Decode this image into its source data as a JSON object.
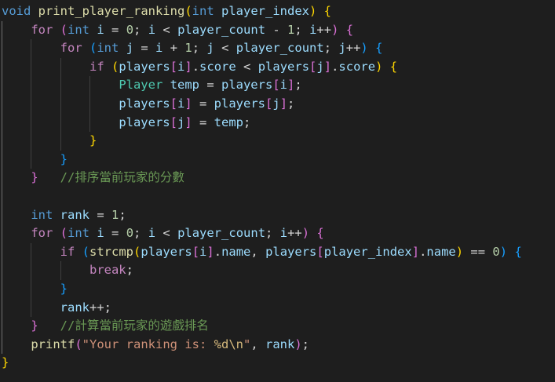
{
  "colors": {
    "background": "#1e1e1e",
    "keyword": "#569cd6",
    "control": "#c586c0",
    "function": "#dcdcaa",
    "variable": "#9cdcfe",
    "number": "#b5cea8",
    "string": "#ce9178",
    "type": "#4ec9b0",
    "comment": "#6a9955",
    "bracket_gold": "#ffd700",
    "bracket_orchid": "#da70d6",
    "bracket_blue": "#179fff"
  },
  "code": {
    "lines": [
      [
        [
          "void",
          "kw"
        ],
        [
          " ",
          "op"
        ],
        [
          "print_player_ranking",
          "fn"
        ],
        [
          "(",
          "b1"
        ],
        [
          "int",
          "kw"
        ],
        [
          " ",
          "op"
        ],
        [
          "player_index",
          "var"
        ],
        [
          ")",
          "b1"
        ],
        [
          " ",
          "op"
        ],
        [
          "{",
          "b1"
        ]
      ],
      [
        [
          "    ",
          "op"
        ],
        [
          "for",
          "ctl"
        ],
        [
          " ",
          "op"
        ],
        [
          "(",
          "b2"
        ],
        [
          "int",
          "kw"
        ],
        [
          " ",
          "op"
        ],
        [
          "i",
          "var"
        ],
        [
          " = ",
          "op"
        ],
        [
          "0",
          "num"
        ],
        [
          "; ",
          "op"
        ],
        [
          "i",
          "var"
        ],
        [
          " < ",
          "op"
        ],
        [
          "player_count",
          "var"
        ],
        [
          " - ",
          "op"
        ],
        [
          "1",
          "num"
        ],
        [
          "; ",
          "op"
        ],
        [
          "i",
          "var"
        ],
        [
          "++",
          "op"
        ],
        [
          ")",
          "b2"
        ],
        [
          " ",
          "op"
        ],
        [
          "{",
          "b2"
        ]
      ],
      [
        [
          "        ",
          "op"
        ],
        [
          "for",
          "ctl"
        ],
        [
          " ",
          "op"
        ],
        [
          "(",
          "b3"
        ],
        [
          "int",
          "kw"
        ],
        [
          " ",
          "op"
        ],
        [
          "j",
          "var"
        ],
        [
          " = ",
          "op"
        ],
        [
          "i",
          "var"
        ],
        [
          " + ",
          "op"
        ],
        [
          "1",
          "num"
        ],
        [
          "; ",
          "op"
        ],
        [
          "j",
          "var"
        ],
        [
          " < ",
          "op"
        ],
        [
          "player_count",
          "var"
        ],
        [
          "; ",
          "op"
        ],
        [
          "j",
          "var"
        ],
        [
          "++",
          "op"
        ],
        [
          ")",
          "b3"
        ],
        [
          " ",
          "op"
        ],
        [
          "{",
          "b3"
        ]
      ],
      [
        [
          "            ",
          "op"
        ],
        [
          "if",
          "ctl"
        ],
        [
          " ",
          "op"
        ],
        [
          "(",
          "b1"
        ],
        [
          "players",
          "var"
        ],
        [
          "[",
          "b2"
        ],
        [
          "i",
          "var"
        ],
        [
          "]",
          "b2"
        ],
        [
          ".",
          "op"
        ],
        [
          "score",
          "var"
        ],
        [
          " < ",
          "op"
        ],
        [
          "players",
          "var"
        ],
        [
          "[",
          "b2"
        ],
        [
          "j",
          "var"
        ],
        [
          "]",
          "b2"
        ],
        [
          ".",
          "op"
        ],
        [
          "score",
          "var"
        ],
        [
          ")",
          "b1"
        ],
        [
          " ",
          "op"
        ],
        [
          "{",
          "b1"
        ]
      ],
      [
        [
          "                ",
          "op"
        ],
        [
          "Player",
          "typ"
        ],
        [
          " ",
          "op"
        ],
        [
          "temp",
          "var"
        ],
        [
          " = ",
          "op"
        ],
        [
          "players",
          "var"
        ],
        [
          "[",
          "b2"
        ],
        [
          "i",
          "var"
        ],
        [
          "]",
          "b2"
        ],
        [
          ";",
          "op"
        ]
      ],
      [
        [
          "                ",
          "op"
        ],
        [
          "players",
          "var"
        ],
        [
          "[",
          "b2"
        ],
        [
          "i",
          "var"
        ],
        [
          "]",
          "b2"
        ],
        [
          " = ",
          "op"
        ],
        [
          "players",
          "var"
        ],
        [
          "[",
          "b2"
        ],
        [
          "j",
          "var"
        ],
        [
          "]",
          "b2"
        ],
        [
          ";",
          "op"
        ]
      ],
      [
        [
          "                ",
          "op"
        ],
        [
          "players",
          "var"
        ],
        [
          "[",
          "b2"
        ],
        [
          "j",
          "var"
        ],
        [
          "]",
          "b2"
        ],
        [
          " = ",
          "op"
        ],
        [
          "temp",
          "var"
        ],
        [
          ";",
          "op"
        ]
      ],
      [
        [
          "            ",
          "op"
        ],
        [
          "}",
          "b1"
        ]
      ],
      [
        [
          "        ",
          "op"
        ],
        [
          "}",
          "b3"
        ]
      ],
      [
        [
          "    ",
          "op"
        ],
        [
          "}",
          "b2"
        ],
        [
          "   ",
          "op"
        ],
        [
          "//排序當前玩家的分數",
          "cmt"
        ]
      ],
      [
        [
          "",
          "op"
        ]
      ],
      [
        [
          "    ",
          "op"
        ],
        [
          "int",
          "kw"
        ],
        [
          " ",
          "op"
        ],
        [
          "rank",
          "var"
        ],
        [
          " = ",
          "op"
        ],
        [
          "1",
          "num"
        ],
        [
          ";",
          "op"
        ]
      ],
      [
        [
          "    ",
          "op"
        ],
        [
          "for",
          "ctl"
        ],
        [
          " ",
          "op"
        ],
        [
          "(",
          "b2"
        ],
        [
          "int",
          "kw"
        ],
        [
          " ",
          "op"
        ],
        [
          "i",
          "var"
        ],
        [
          " = ",
          "op"
        ],
        [
          "0",
          "num"
        ],
        [
          "; ",
          "op"
        ],
        [
          "i",
          "var"
        ],
        [
          " < ",
          "op"
        ],
        [
          "player_count",
          "var"
        ],
        [
          "; ",
          "op"
        ],
        [
          "i",
          "var"
        ],
        [
          "++",
          "op"
        ],
        [
          ")",
          "b2"
        ],
        [
          " ",
          "op"
        ],
        [
          "{",
          "b2"
        ]
      ],
      [
        [
          "        ",
          "op"
        ],
        [
          "if",
          "ctl"
        ],
        [
          " ",
          "op"
        ],
        [
          "(",
          "b3"
        ],
        [
          "strcmp",
          "fn"
        ],
        [
          "(",
          "b1"
        ],
        [
          "players",
          "var"
        ],
        [
          "[",
          "b2"
        ],
        [
          "i",
          "var"
        ],
        [
          "]",
          "b2"
        ],
        [
          ".",
          "op"
        ],
        [
          "name",
          "var"
        ],
        [
          ", ",
          "op"
        ],
        [
          "players",
          "var"
        ],
        [
          "[",
          "b2"
        ],
        [
          "player_index",
          "var"
        ],
        [
          "]",
          "b2"
        ],
        [
          ".",
          "op"
        ],
        [
          "name",
          "var"
        ],
        [
          ")",
          "b1"
        ],
        [
          " == ",
          "op"
        ],
        [
          "0",
          "num"
        ],
        [
          ")",
          "b3"
        ],
        [
          " ",
          "op"
        ],
        [
          "{",
          "b3"
        ]
      ],
      [
        [
          "            ",
          "op"
        ],
        [
          "break",
          "ctl"
        ],
        [
          ";",
          "op"
        ]
      ],
      [
        [
          "        ",
          "op"
        ],
        [
          "}",
          "b3"
        ]
      ],
      [
        [
          "        ",
          "op"
        ],
        [
          "rank",
          "var"
        ],
        [
          "++",
          "op"
        ],
        [
          ";",
          "op"
        ]
      ],
      [
        [
          "    ",
          "op"
        ],
        [
          "}",
          "b2"
        ],
        [
          "   ",
          "op"
        ],
        [
          "//計算當前玩家的遊戲排名",
          "cmt"
        ]
      ],
      [
        [
          "    ",
          "op"
        ],
        [
          "printf",
          "fn"
        ],
        [
          "(",
          "b2"
        ],
        [
          "\"Your ranking is: ",
          "str"
        ],
        [
          "%d\\n",
          "esc"
        ],
        [
          "\"",
          "str"
        ],
        [
          ", ",
          "op"
        ],
        [
          "rank",
          "var"
        ],
        [
          ")",
          "b2"
        ],
        [
          ";",
          "op"
        ]
      ],
      [
        [
          "}",
          "b1"
        ]
      ]
    ]
  }
}
